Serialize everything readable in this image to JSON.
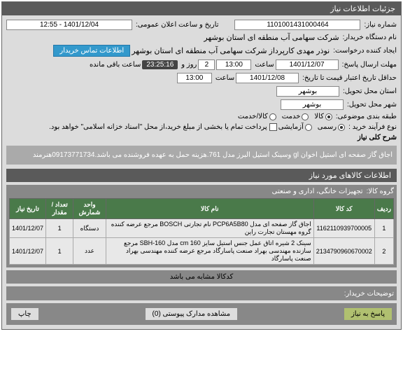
{
  "header": {
    "title": "جزئیات اطلاعات نیاز"
  },
  "fields": {
    "need_no_label": "شماره نیاز:",
    "need_no": "1101001431000464",
    "announce_label": "تاریخ و ساعت اعلان عمومی:",
    "announce_val": "1401/12/04 - 12:55",
    "buyer_label": "نام دستگاه خریدار:",
    "buyer_val": "شرکت سهامی آب منطقه ای استان بوشهر",
    "creator_label": "ایجاد کننده درخواست:",
    "creator_val": "نوذر مهدی کارپرداز شرکت سهامی آب منطقه ای استان بوشهر",
    "contact_btn": "اطلاعات تماس خریدار",
    "deadline_label": "مهلت ارسال پاسخ:",
    "deadline_date": "1401/12/07",
    "deadline_hour_lbl": "ساعت",
    "deadline_hour": "13:00",
    "day_lbl": "روز و",
    "day_val": "2",
    "timer": "23:25:16",
    "remain_lbl": "ساعت باقی مانده",
    "valid_label": "حداقل تاریخ اعتبار قیمت تا تاریخ:",
    "valid_date": "1401/12/08",
    "valid_hour": "13:00",
    "delivery_state_lbl": "استان محل تحویل:",
    "delivery_state": "بوشهر",
    "delivery_city_lbl": "شهر محل تحویل:",
    "delivery_city": "بوشهر",
    "category_lbl": "طبقه بندی موضوعی:",
    "cat_goods": "کالا",
    "cat_service": "خدمت",
    "cat_both": "کالا/خدمت",
    "process_lbl": "نوع فرآیند خرید :",
    "process_official": "رسمی",
    "process_trial": "آزمایشی",
    "payment_note": "پرداخت تمام یا بخشی از مبلغ خرید،از محل \"اسناد خزانه اسلامی\" خواهد بود.",
    "desc_lbl": "شرح کلی نیاز",
    "desc_text": "اجاق گاز صفحه ای استیل اخوان gl وسینک استیل البرز مدل 761.هزینه حمل به عهده فروشنده می باشد.09173771734هنرمند",
    "items_header": "اطلاعات کالاهای مورد نیاز",
    "group_lbl": "گروه کالا:",
    "group_val": "تجهیزات خانگی، اداری و صنعتی"
  },
  "table": {
    "headers": [
      "ردیف",
      "کد کالا",
      "نام کالا",
      "واحد شمارش",
      "تعداد / مقدار",
      "تاریخ نیاز"
    ],
    "rows": [
      {
        "n": "1",
        "code": "1162110939700005",
        "name": "اجاق گاز صفحه ای مدل PCP6A5B80 نام تجارتی BOSCH مرجع عرضه کننده گروه مهستان تجارت راین",
        "unit": "دستگاه",
        "qty": "1",
        "date": "1401/12/07"
      },
      {
        "n": "2",
        "code": "2134790960670002",
        "name": "سینک 2 شیره اتاق عمل جنس استیل سایز cm 160 مدل SBH-160 مرجع سازنده مهندسی بهراد صنعت پاسارگاد مرجع عرضه کننده مهندسی بهراد صنعت پاسارگاد",
        "unit": "عدد",
        "qty": "1",
        "date": "1401/12/07"
      }
    ]
  },
  "similar": "کدکالا مشابه می باشد",
  "buyer_notes_lbl": "توضیحات خریدار:",
  "footer": {
    "reply": "پاسخ به نیاز",
    "attach": "مشاهده مدارک پیوستی (0)",
    "print": "چاپ"
  }
}
